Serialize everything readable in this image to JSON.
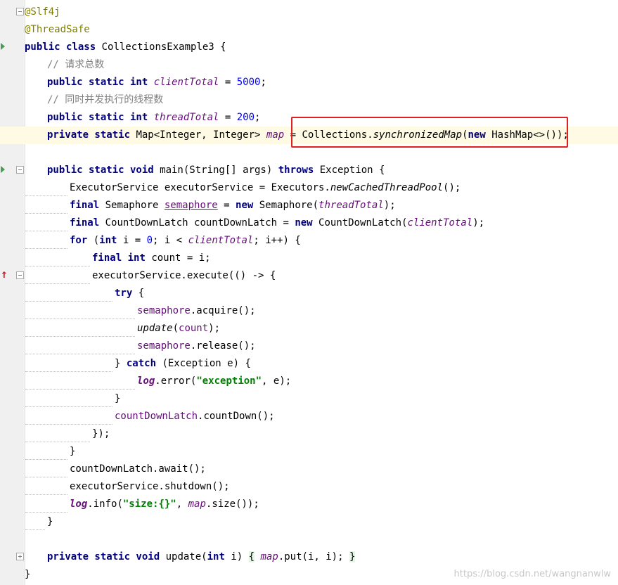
{
  "code": {
    "ann_slf4j": "@Slf4j",
    "ann_threadsafe": "@ThreadSafe",
    "class_kw": "public class",
    "class_name": " CollectionsExample3 {",
    "comment_total": "// 请求总数",
    "kw_psi": "public static int",
    "client_total_name": "clientTotal",
    "eq": " = ",
    "client_total_value": "5000",
    "semi": ";",
    "comment_threads": "// 同时并发执行的线程数",
    "thread_total_name": "threadTotal",
    "thread_total_value": "200",
    "kw_private_static": "private static",
    "map_type": " Map<Integer, Integer> ",
    "map_name": "map",
    "map_init_1": " = Collections.",
    "map_init_method": "synchronizedMap",
    "map_init_2": "(",
    "kw_new": "new",
    "map_init_3": " HashMap<>());",
    "main_sig_kw": "public static void",
    "main_sig": " main(String[] args) ",
    "kw_throws": "throws",
    "main_sig_end": " Exception {",
    "exec_decl": "ExecutorService executorService = Executors.",
    "exec_method": "newCachedThreadPool",
    "exec_end": "();",
    "kw_final": "final",
    "sem_type": " Semaphore ",
    "sem_name": "semaphore",
    "sem_init": " = ",
    "sem_ctor": " Semaphore(",
    "sem_arg": "threadTotal",
    "close_semi": ");",
    "latch_decl": " CountDownLatch countDownLatch = ",
    "latch_ctor": " CountDownLatch(",
    "latch_arg": "clientTotal",
    "kw_for": "for",
    "for_open": " (",
    "kw_int": "int",
    "for_init": " i = ",
    "zero": "0",
    "for_cond": "; i < ",
    "for_total": "clientTotal",
    "for_end": "; i++) {",
    "count_decl": " count = i;",
    "execute_call": "executorService.execute(() -> {",
    "kw_try": "try",
    "try_open": " {",
    "sem_ref": "semaphore",
    "acquire_call": ".acquire();",
    "update_method": "update",
    "update_arg": "count",
    "release_call": ".release();",
    "catch_close": "} ",
    "kw_catch": "catch",
    "catch_sig": " (Exception e) {",
    "log_name": "log",
    "log_error": ".error(",
    "log_error_str": "\"exception\"",
    "log_error_end": ", e);",
    "close_brace": "}",
    "latch_ref": "countDownLatch",
    "countdown_call": ".countDown();",
    "lambda_close": "});",
    "await_call": "countDownLatch.await();",
    "shutdown_call": "executorService.shutdown();",
    "log_info": ".info(",
    "log_info_str": "\"size:{}\"",
    "comma_space": ", ",
    "map_ref": "map",
    "size_call": ".size());",
    "update_sig_kw": "private static void",
    "update_sig": " update(",
    "update_param": " i) ",
    "update_body_open": "{",
    "update_body": " .put(i, i); ",
    "update_body_close": "}",
    "class_close": "}"
  },
  "watermark": "https://blog.csdn.net/wangnanwlw"
}
